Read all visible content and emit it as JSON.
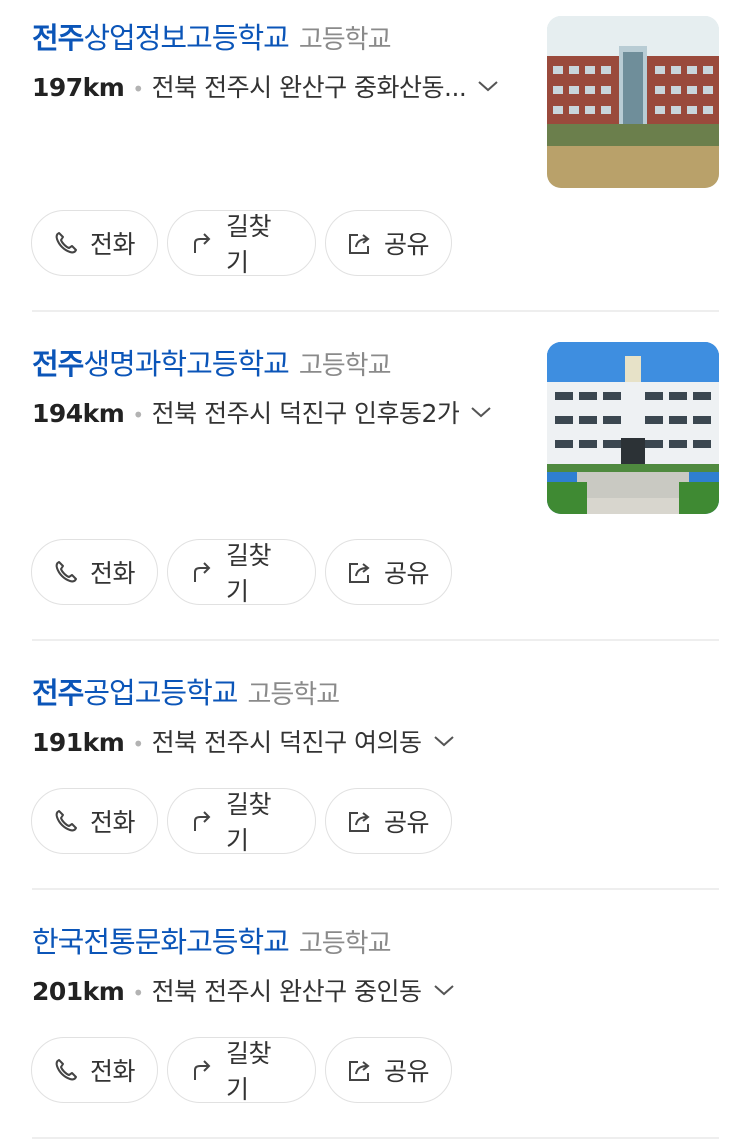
{
  "results": [
    {
      "name_highlight": "전주",
      "name_rest": "상업정보고등학교",
      "category": "고등학교",
      "distance": "197km",
      "address": "전북 전주시 완산구 중화산동...",
      "has_thumbnail": true,
      "thumbnail_label": "school-building-photo"
    },
    {
      "name_highlight": "전주",
      "name_rest": "생명과학고등학교",
      "category": "고등학교",
      "distance": "194km",
      "address": "전북 전주시 덕진구 인후동2가",
      "has_thumbnail": true,
      "thumbnail_label": "school-building-photo"
    },
    {
      "name_highlight": "전주",
      "name_rest": "공업고등학교",
      "category": "고등학교",
      "distance": "191km",
      "address": "전북 전주시 덕진구 여의동",
      "has_thumbnail": false
    },
    {
      "name_highlight": "",
      "name_rest": "한국전통문화고등학교",
      "category": "고등학교",
      "distance": "201km",
      "address": "전북 전주시 완산구 중인동",
      "has_thumbnail": false
    }
  ],
  "actions": {
    "call_label": "전화",
    "directions_label": "길찾기",
    "share_label": "공유"
  },
  "icons": {
    "call": "phone-icon",
    "directions": "turn-arrow-icon",
    "share": "share-icon",
    "expand": "chevron-down-icon"
  },
  "colors": {
    "title": "#0b55b8",
    "category": "#8a8a8a",
    "divider": "#eeeeee"
  }
}
